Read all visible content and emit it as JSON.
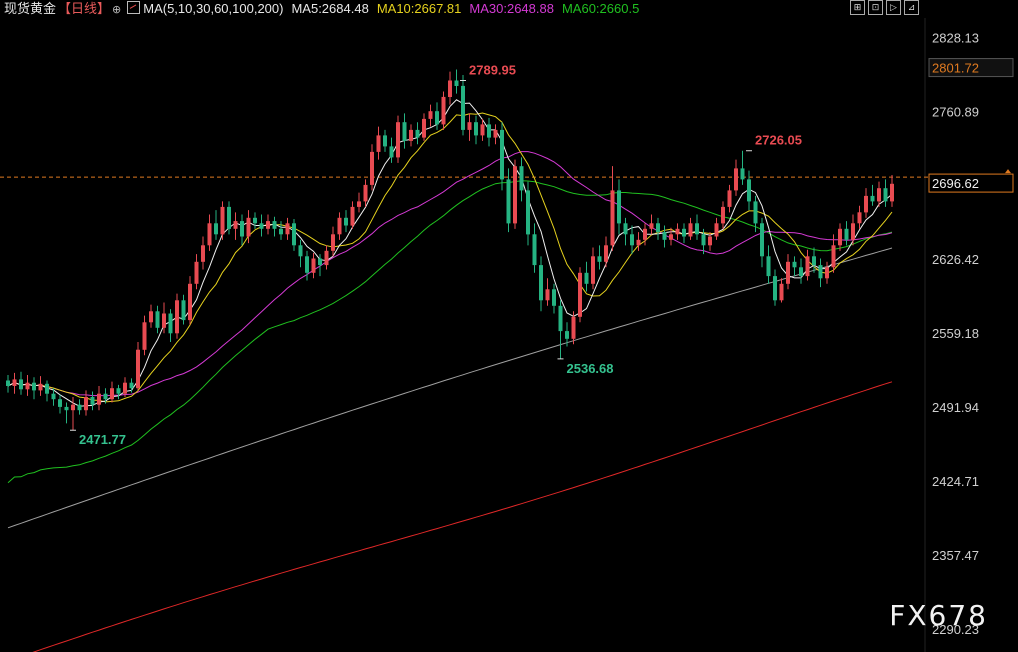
{
  "header": {
    "instrument": "现货黄金",
    "period": "【日线】",
    "circle_glyph": "⊕",
    "ma_params": "MA(5,10,30,60,100,200)",
    "ma5": "MA5:2684.48",
    "ma10": "MA10:2667.81",
    "ma30": "MA30:2648.88",
    "ma60": "MA60:2660.5"
  },
  "toolbar": [
    "⊞",
    "⊡",
    "▷",
    "⊿"
  ],
  "watermark": "FX678",
  "colors": {
    "up": "#e84b52",
    "down": "#25b382",
    "ma5": "#f0f0f0",
    "ma10": "#e6d21e",
    "ma30": "#d43ad4",
    "ma60": "#20c020",
    "ma100": "#a0a0a0",
    "ma200": "#e02828",
    "current_line": "#e07a20",
    "axis_text": "#d0d0d0",
    "price_box_bg": "#000",
    "price_box_border": "#e07a20"
  },
  "chart_data": {
    "type": "candlestick",
    "ylim": [
      2270,
      2845
    ],
    "yticks": [
      "2828.13",
      "2760.89",
      "2693.66",
      "2626.42",
      "2559.18",
      "2491.94",
      "2424.71",
      "2357.47",
      "2290.23"
    ],
    "current_price": "2696.62",
    "highlighted_price": "2801.72",
    "annotations": [
      {
        "text": "2789.95",
        "value": 2789.95,
        "index": 70,
        "color": "up"
      },
      {
        "text": "2726.05",
        "value": 2726.05,
        "index": 114,
        "color": "up"
      },
      {
        "text": "2536.68",
        "value": 2536.68,
        "index": 85,
        "color": "down"
      },
      {
        "text": "2471.77",
        "value": 2471.77,
        "index": 10,
        "color": "down"
      }
    ],
    "candles": [
      [
        2517,
        2512,
        2522,
        2506
      ],
      [
        2512,
        2518,
        2524,
        2505
      ],
      [
        2518,
        2509,
        2525,
        2504
      ],
      [
        2509,
        2515,
        2522,
        2503
      ],
      [
        2515,
        2508,
        2520,
        2500
      ],
      [
        2508,
        2514,
        2521,
        2503
      ],
      [
        2514,
        2505,
        2517,
        2498
      ],
      [
        2505,
        2500,
        2510,
        2494
      ],
      [
        2500,
        2493,
        2504,
        2487
      ],
      [
        2493,
        2490,
        2497,
        2478
      ],
      [
        2490,
        2495,
        2502,
        2472
      ],
      [
        2495,
        2490,
        2500,
        2486
      ],
      [
        2490,
        2502,
        2508,
        2485
      ],
      [
        2502,
        2495,
        2507,
        2490
      ],
      [
        2495,
        2505,
        2512,
        2490
      ],
      [
        2505,
        2500,
        2510,
        2496
      ],
      [
        2500,
        2510,
        2516,
        2497
      ],
      [
        2510,
        2505,
        2513,
        2500
      ],
      [
        2505,
        2515,
        2520,
        2502
      ],
      [
        2515,
        2510,
        2519,
        2506
      ],
      [
        2510,
        2545,
        2552,
        2508
      ],
      [
        2545,
        2570,
        2576,
        2540
      ],
      [
        2570,
        2580,
        2586,
        2565
      ],
      [
        2580,
        2565,
        2585,
        2560
      ],
      [
        2565,
        2578,
        2588,
        2560
      ],
      [
        2578,
        2560,
        2582,
        2552
      ],
      [
        2560,
        2590,
        2596,
        2555
      ],
      [
        2590,
        2572,
        2595,
        2568
      ],
      [
        2572,
        2605,
        2612,
        2568
      ],
      [
        2605,
        2625,
        2632,
        2600
      ],
      [
        2625,
        2640,
        2648,
        2618
      ],
      [
        2640,
        2660,
        2668,
        2635
      ],
      [
        2660,
        2650,
        2672,
        2645
      ],
      [
        2650,
        2675,
        2680,
        2645
      ],
      [
        2675,
        2655,
        2680,
        2650
      ],
      [
        2655,
        2662,
        2670,
        2645
      ],
      [
        2662,
        2648,
        2668,
        2640
      ],
      [
        2648,
        2665,
        2672,
        2642
      ],
      [
        2665,
        2660,
        2670,
        2655
      ],
      [
        2660,
        2655,
        2668,
        2648
      ],
      [
        2655,
        2662,
        2668,
        2650
      ],
      [
        2662,
        2655,
        2666,
        2648
      ],
      [
        2655,
        2650,
        2662,
        2645
      ],
      [
        2650,
        2660,
        2665,
        2645
      ],
      [
        2660,
        2640,
        2664,
        2635
      ],
      [
        2640,
        2630,
        2645,
        2620
      ],
      [
        2630,
        2615,
        2635,
        2608
      ],
      [
        2615,
        2628,
        2633,
        2610
      ],
      [
        2628,
        2622,
        2632,
        2612
      ],
      [
        2622,
        2635,
        2640,
        2618
      ],
      [
        2635,
        2650,
        2657,
        2630
      ],
      [
        2650,
        2665,
        2670,
        2645
      ],
      [
        2665,
        2658,
        2672,
        2652
      ],
      [
        2658,
        2675,
        2680,
        2655
      ],
      [
        2675,
        2680,
        2688,
        2670
      ],
      [
        2680,
        2695,
        2700,
        2675
      ],
      [
        2695,
        2725,
        2732,
        2690
      ],
      [
        2725,
        2740,
        2748,
        2718
      ],
      [
        2740,
        2730,
        2745,
        2725
      ],
      [
        2730,
        2720,
        2738,
        2715
      ],
      [
        2720,
        2752,
        2758,
        2715
      ],
      [
        2752,
        2735,
        2760,
        2728
      ],
      [
        2735,
        2745,
        2750,
        2730
      ],
      [
        2745,
        2738,
        2752,
        2732
      ],
      [
        2738,
        2755,
        2760,
        2735
      ],
      [
        2755,
        2762,
        2768,
        2748
      ],
      [
        2762,
        2750,
        2770,
        2745
      ],
      [
        2750,
        2775,
        2780,
        2745
      ],
      [
        2775,
        2790,
        2798,
        2768
      ],
      [
        2790,
        2785,
        2800,
        2778
      ],
      [
        2785,
        2745,
        2795,
        2740
      ],
      [
        2745,
        2752,
        2760,
        2735
      ],
      [
        2752,
        2740,
        2758,
        2732
      ],
      [
        2740,
        2750,
        2755,
        2735
      ],
      [
        2750,
        2738,
        2756,
        2730
      ],
      [
        2738,
        2745,
        2750,
        2732
      ],
      [
        2745,
        2700,
        2752,
        2690
      ],
      [
        2700,
        2660,
        2710,
        2652
      ],
      [
        2660,
        2712,
        2718,
        2655
      ],
      [
        2712,
        2690,
        2720,
        2680
      ],
      [
        2690,
        2650,
        2698,
        2640
      ],
      [
        2650,
        2622,
        2660,
        2615
      ],
      [
        2622,
        2590,
        2630,
        2580
      ],
      [
        2590,
        2600,
        2610,
        2585
      ],
      [
        2600,
        2585,
        2605,
        2578
      ],
      [
        2585,
        2562,
        2590,
        2537
      ],
      [
        2562,
        2555,
        2570,
        2548
      ],
      [
        2555,
        2575,
        2580,
        2550
      ],
      [
        2575,
        2615,
        2620,
        2570
      ],
      [
        2615,
        2605,
        2625,
        2598
      ],
      [
        2605,
        2630,
        2638,
        2600
      ],
      [
        2630,
        2625,
        2640,
        2618
      ],
      [
        2625,
        2640,
        2648,
        2620
      ],
      [
        2640,
        2690,
        2712,
        2635
      ],
      [
        2690,
        2660,
        2700,
        2650
      ],
      [
        2660,
        2650,
        2665,
        2640
      ],
      [
        2650,
        2640,
        2658,
        2632
      ],
      [
        2640,
        2645,
        2652,
        2635
      ],
      [
        2645,
        2655,
        2660,
        2640
      ],
      [
        2655,
        2660,
        2668,
        2650
      ],
      [
        2660,
        2652,
        2665,
        2645
      ],
      [
        2652,
        2645,
        2658,
        2638
      ],
      [
        2645,
        2650,
        2656,
        2640
      ],
      [
        2650,
        2655,
        2660,
        2645
      ],
      [
        2655,
        2648,
        2660,
        2642
      ],
      [
        2648,
        2660,
        2665,
        2645
      ],
      [
        2660,
        2650,
        2668,
        2645
      ],
      [
        2650,
        2640,
        2655,
        2632
      ],
      [
        2640,
        2648,
        2652,
        2635
      ],
      [
        2648,
        2660,
        2665,
        2645
      ],
      [
        2660,
        2675,
        2680,
        2655
      ],
      [
        2675,
        2690,
        2695,
        2670
      ],
      [
        2690,
        2710,
        2718,
        2685
      ],
      [
        2710,
        2700,
        2726,
        2695
      ],
      [
        2700,
        2680,
        2708,
        2672
      ],
      [
        2680,
        2660,
        2685,
        2652
      ],
      [
        2660,
        2630,
        2665,
        2620
      ],
      [
        2630,
        2612,
        2640,
        2605
      ],
      [
        2612,
        2590,
        2618,
        2585
      ],
      [
        2590,
        2605,
        2610,
        2588
      ],
      [
        2605,
        2625,
        2632,
        2600
      ],
      [
        2625,
        2620,
        2630,
        2612
      ],
      [
        2620,
        2612,
        2628,
        2605
      ],
      [
        2612,
        2630,
        2636,
        2608
      ],
      [
        2630,
        2622,
        2638,
        2615
      ],
      [
        2622,
        2610,
        2628,
        2602
      ],
      [
        2610,
        2620,
        2625,
        2605
      ],
      [
        2620,
        2640,
        2650,
        2615
      ],
      [
        2640,
        2655,
        2660,
        2635
      ],
      [
        2655,
        2645,
        2662,
        2640
      ],
      [
        2645,
        2660,
        2668,
        2640
      ],
      [
        2660,
        2670,
        2676,
        2655
      ],
      [
        2670,
        2685,
        2692,
        2665
      ],
      [
        2685,
        2680,
        2695,
        2676
      ],
      [
        2680,
        2692,
        2698,
        2675
      ],
      [
        2692,
        2680,
        2700,
        2675
      ],
      [
        2680,
        2696,
        2704,
        2675
      ]
    ]
  }
}
